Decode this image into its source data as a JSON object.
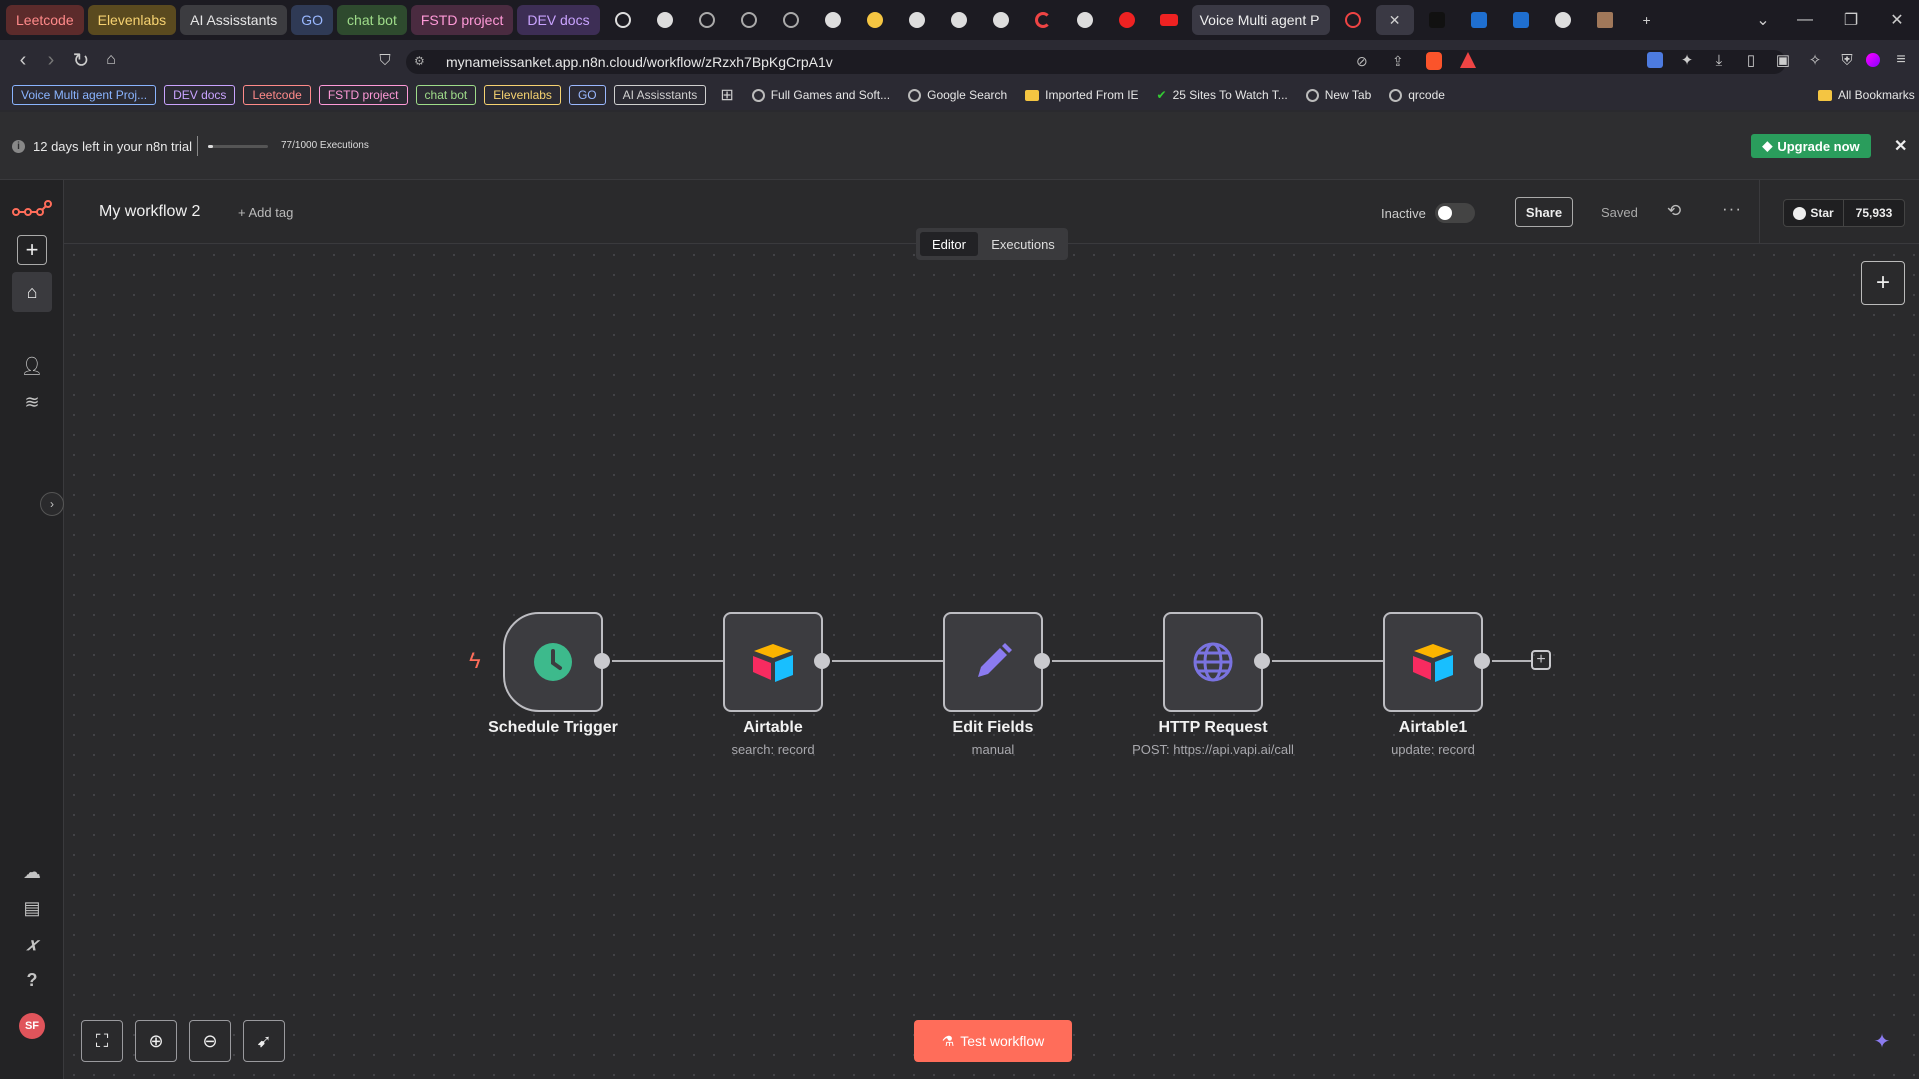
{
  "browser": {
    "tab_groups": [
      {
        "label": "Leetcode",
        "bg": "#5c2b2b",
        "fg": "#ff8a8a"
      },
      {
        "label": "Elevenlabs",
        "bg": "#5a4a1f",
        "fg": "#f6d271"
      },
      {
        "label": "AI Assisstants",
        "bg": "#3c3c40",
        "fg": "#e6e6e6"
      },
      {
        "label": "GO",
        "bg": "#2f3a55",
        "fg": "#9ab8ff"
      },
      {
        "label": "chat bot",
        "bg": "#2e4a2e",
        "fg": "#9fdc8a"
      },
      {
        "label": "FSTD project",
        "bg": "#4a2b40",
        "fg": "#ff9ad8"
      },
      {
        "label": "DEV docs",
        "bg": "#3d2e55",
        "fg": "#c9a3ff"
      }
    ],
    "active_tab_title": "Voice Multi agent P",
    "url": "mynameissanket.app.n8n.cloud/workflow/zRzxh7BpKgCrpA1v",
    "bookmarks_chips": [
      {
        "label": "Voice Multi agent Proj...",
        "color": "#8ab4ff"
      },
      {
        "label": "DEV docs",
        "color": "#c9a3ff"
      },
      {
        "label": "Leetcode",
        "color": "#ff8a8a"
      },
      {
        "label": "FSTD project",
        "color": "#ff9ad8"
      },
      {
        "label": "chat bot",
        "color": "#9fdc8a"
      },
      {
        "label": "Elevenlabs",
        "color": "#f6d271"
      },
      {
        "label": "GO",
        "color": "#9ab8ff"
      },
      {
        "label": "AI Assisstants",
        "color": "#d0d0d0"
      }
    ],
    "bookmark_links": [
      "Full Games and Soft...",
      "Google Search",
      "Imported From IE",
      "25 Sites To Watch T...",
      "New Tab",
      "qrcode"
    ],
    "all_bookmarks": "All Bookmarks"
  },
  "trial": {
    "days_left": "12 days left in your n8n trial",
    "executions": "77/1000 Executions",
    "executions_progress": 0.077,
    "upgrade_label": "Upgrade now"
  },
  "workflow": {
    "name": "My workflow 2",
    "add_tag": "+ Add tag",
    "status_label": "Inactive",
    "share_label": "Share",
    "saved_label": "Saved",
    "star_label": "Star",
    "star_count": "75,933",
    "tabs": {
      "editor": "Editor",
      "executions": "Executions"
    }
  },
  "nodes": [
    {
      "title": "Schedule Trigger",
      "subtitle": "",
      "icon": "clock-icon"
    },
    {
      "title": "Airtable",
      "subtitle": "search: record",
      "icon": "airtable-icon"
    },
    {
      "title": "Edit Fields",
      "subtitle": "manual",
      "icon": "pencil-icon"
    },
    {
      "title": "HTTP Request",
      "subtitle": "POST: https://api.vapi.ai/call",
      "icon": "globe-icon"
    },
    {
      "title": "Airtable1",
      "subtitle": "update: record",
      "icon": "airtable-icon"
    }
  ],
  "test_workflow_label": "Test workflow",
  "user_initials": "SF",
  "colors": {
    "accent": "#ff6d5a",
    "upgrade_green": "#2a9d5c",
    "clock_green": "#3dba8c",
    "pencil_purple": "#8b7bf0",
    "globe_purple": "#7a73e0"
  }
}
